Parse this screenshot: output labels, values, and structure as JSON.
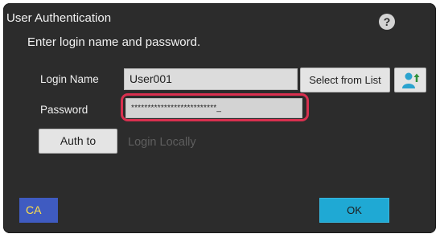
{
  "dialog": {
    "title": "User Authentication",
    "subtitle": "Enter login name and password.",
    "help_glyph": "?"
  },
  "login": {
    "label": "Login Name",
    "value": "User001"
  },
  "password": {
    "label": "Password",
    "masked_value": "**************************_"
  },
  "buttons": {
    "select_from_list": "Select from List",
    "auth_to": "Auth to",
    "ca": "CA",
    "ok": "OK"
  },
  "auth_target": "Login Locally",
  "icons": {
    "user_lookup": "user-arrow-icon"
  },
  "colors": {
    "panel": "#2c2c2c",
    "highlight": "#d9304f",
    "ca_bg": "#3f5bc1",
    "ca_text": "#ffe04a",
    "ok_bg": "#1fa9d4",
    "user_icon": "#2ba3cf"
  }
}
